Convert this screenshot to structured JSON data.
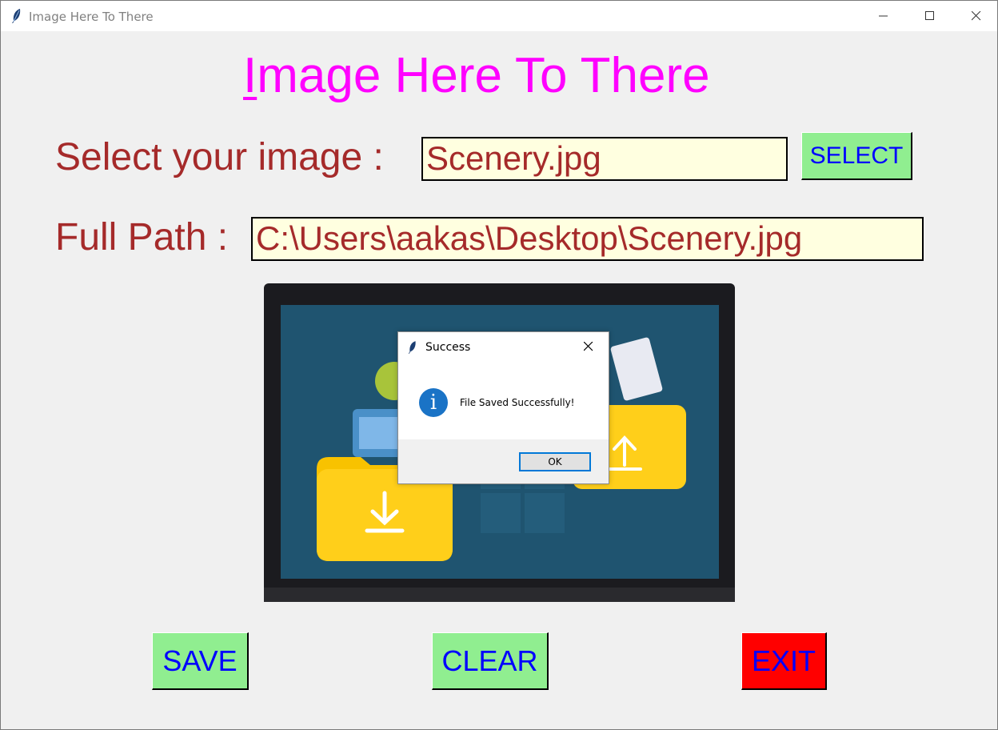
{
  "window": {
    "title": "Image Here To There"
  },
  "heading": {
    "first_letter": "I",
    "rest": "mage Here To There"
  },
  "select_row": {
    "label": "Select your image  :",
    "value": "Scenery.jpg",
    "button": "SELECT"
  },
  "path_row": {
    "label": "Full Path :",
    "value": "C:\\Users\\aakas\\Desktop\\Scenery.jpg"
  },
  "buttons": {
    "save": "SAVE",
    "clear": "CLEAR",
    "exit": "EXIT"
  },
  "dialog": {
    "title": "Success",
    "message": "File Saved Successfully!",
    "ok": "OK"
  },
  "colors": {
    "heading": "#ff00ff",
    "label": "#a52a2a",
    "entry_bg": "#ffffe0",
    "button_bg": "#90ee90",
    "button_text": "#0000ff",
    "exit_bg": "#ff0000"
  },
  "icons": [
    "feather-icon",
    "minimize-icon",
    "maximize-icon",
    "close-icon",
    "info-icon"
  ]
}
